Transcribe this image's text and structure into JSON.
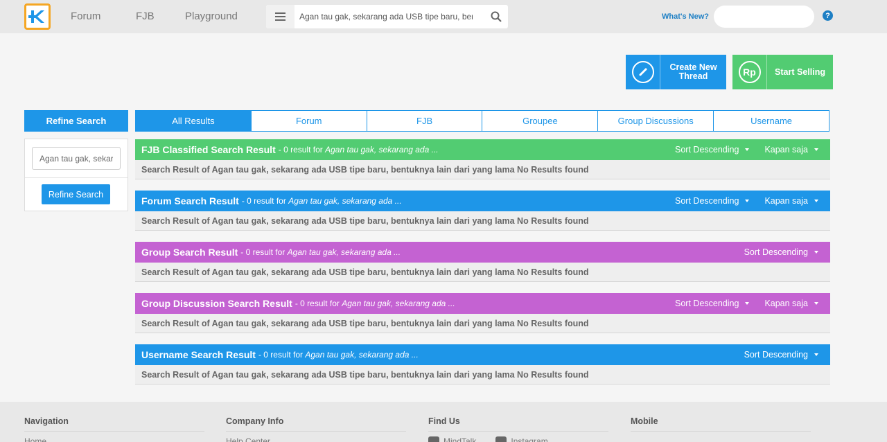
{
  "header": {
    "logo_icon": "kaskus-k-logo-icon",
    "nav": [
      {
        "label": "Forum"
      },
      {
        "label": "FJB"
      },
      {
        "label": "Playground"
      }
    ],
    "search_value": "Agan tau gak, sekarang ada USB tipe baru, bentuknya lain dari yang lama",
    "whats_new": "What's New?",
    "help": "?"
  },
  "actions": {
    "create_thread": "Create New Thread",
    "start_selling": "Start Selling",
    "start_selling_glyph": "Rp"
  },
  "sidebar": {
    "title": "Refine Search",
    "input_value": "Agan tau gak, sekarang ada USB tipe baru, bentuknya lain dari yang lama",
    "button": "Refine Search"
  },
  "tabs": [
    {
      "label": "All Results",
      "active": true
    },
    {
      "label": "Forum"
    },
    {
      "label": "FJB"
    },
    {
      "label": "Groupee"
    },
    {
      "label": "Group Discussions"
    },
    {
      "label": "Username"
    }
  ],
  "sections": [
    {
      "title": "FJB Classified Search Result",
      "meta_prefix": "- 0 result for",
      "query": "Agan tau gak, sekarang ada ...",
      "sort": "Sort Descending",
      "time": "Kapan saja",
      "color": "#52cc72",
      "body": "Search Result of Agan tau gak, sekarang ada USB tipe baru, bentuknya lain dari yang lama No Results found"
    },
    {
      "title": "Forum Search Result",
      "meta_prefix": "- 0 result for",
      "query": "Agan tau gak, sekarang ada ...",
      "sort": "Sort Descending",
      "time": "Kapan saja",
      "color": "#1e96e8",
      "body": "Search Result of Agan tau gak, sekarang ada USB tipe baru, bentuknya lain dari yang lama No Results found"
    },
    {
      "title": "Group Search Result",
      "meta_prefix": "- 0 result for",
      "query": "Agan tau gak, sekarang ada ...",
      "sort": "Sort Descending",
      "time": "",
      "color": "#c462d2",
      "body": "Search Result of Agan tau gak, sekarang ada USB tipe baru, bentuknya lain dari yang lama No Results found"
    },
    {
      "title": "Group Discussion Search Result",
      "meta_prefix": "- 0 result for",
      "query": "Agan tau gak, sekarang ada ...",
      "sort": "Sort Descending",
      "time": "Kapan saja",
      "color": "#c462d2",
      "body": "Search Result of Agan tau gak, sekarang ada USB tipe baru, bentuknya lain dari yang lama No Results found"
    },
    {
      "title": "Username Search Result",
      "meta_prefix": "- 0 result for",
      "query": "Agan tau gak, sekarang ada ...",
      "sort": "Sort Descending",
      "time": "",
      "color": "#1e96e8",
      "body": "Search Result of Agan tau gak, sekarang ada USB tipe baru, bentuknya lain dari yang lama No Results found"
    }
  ],
  "footer": {
    "columns": [
      {
        "title": "Navigation",
        "links": [
          {
            "label": "Home"
          }
        ]
      },
      {
        "title": "Company Info",
        "links": [
          {
            "label": "Help Center"
          }
        ]
      },
      {
        "title": "Find Us",
        "links": [
          {
            "label": "MindTalk",
            "icon": "mindtalk-icon"
          },
          {
            "label": "Instagram",
            "icon": "instagram-icon"
          }
        ]
      },
      {
        "title": "Mobile",
        "links": []
      }
    ]
  }
}
